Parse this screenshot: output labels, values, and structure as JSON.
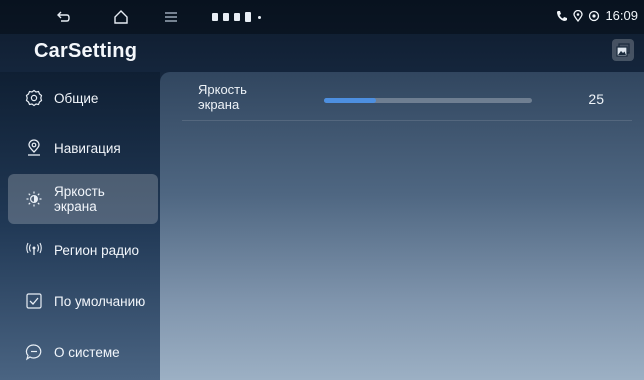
{
  "status_bar": {
    "clock": "16:09",
    "icons": [
      "back-icon",
      "home-icon",
      "menu-icon",
      "phone-icon",
      "location-icon",
      "hotspot-icon"
    ],
    "notification_icons": [
      "usb-icon",
      "usb-icon",
      "media-icon",
      "battery-icon",
      "more-dot-icon"
    ]
  },
  "header": {
    "title": "CarSetting",
    "screen_button_icon": "gallery-icon"
  },
  "sidebar": {
    "items": [
      {
        "label": "Общие",
        "icon": "gear-icon"
      },
      {
        "label": "Навигация",
        "icon": "location-pin-icon"
      },
      {
        "label": "Яркость\nэкрана",
        "icon": "brightness-icon",
        "active": true
      },
      {
        "label": "Регион радио",
        "icon": "radio-icon"
      },
      {
        "label": "По умолчанию",
        "icon": "checkbox-icon"
      },
      {
        "label": "О системе",
        "icon": "chat-info-icon"
      }
    ]
  },
  "main": {
    "brightness": {
      "label": "Яркость\nэкрана",
      "value": "25",
      "level_percent": 25,
      "accent_color": "#4d8fe0"
    }
  }
}
